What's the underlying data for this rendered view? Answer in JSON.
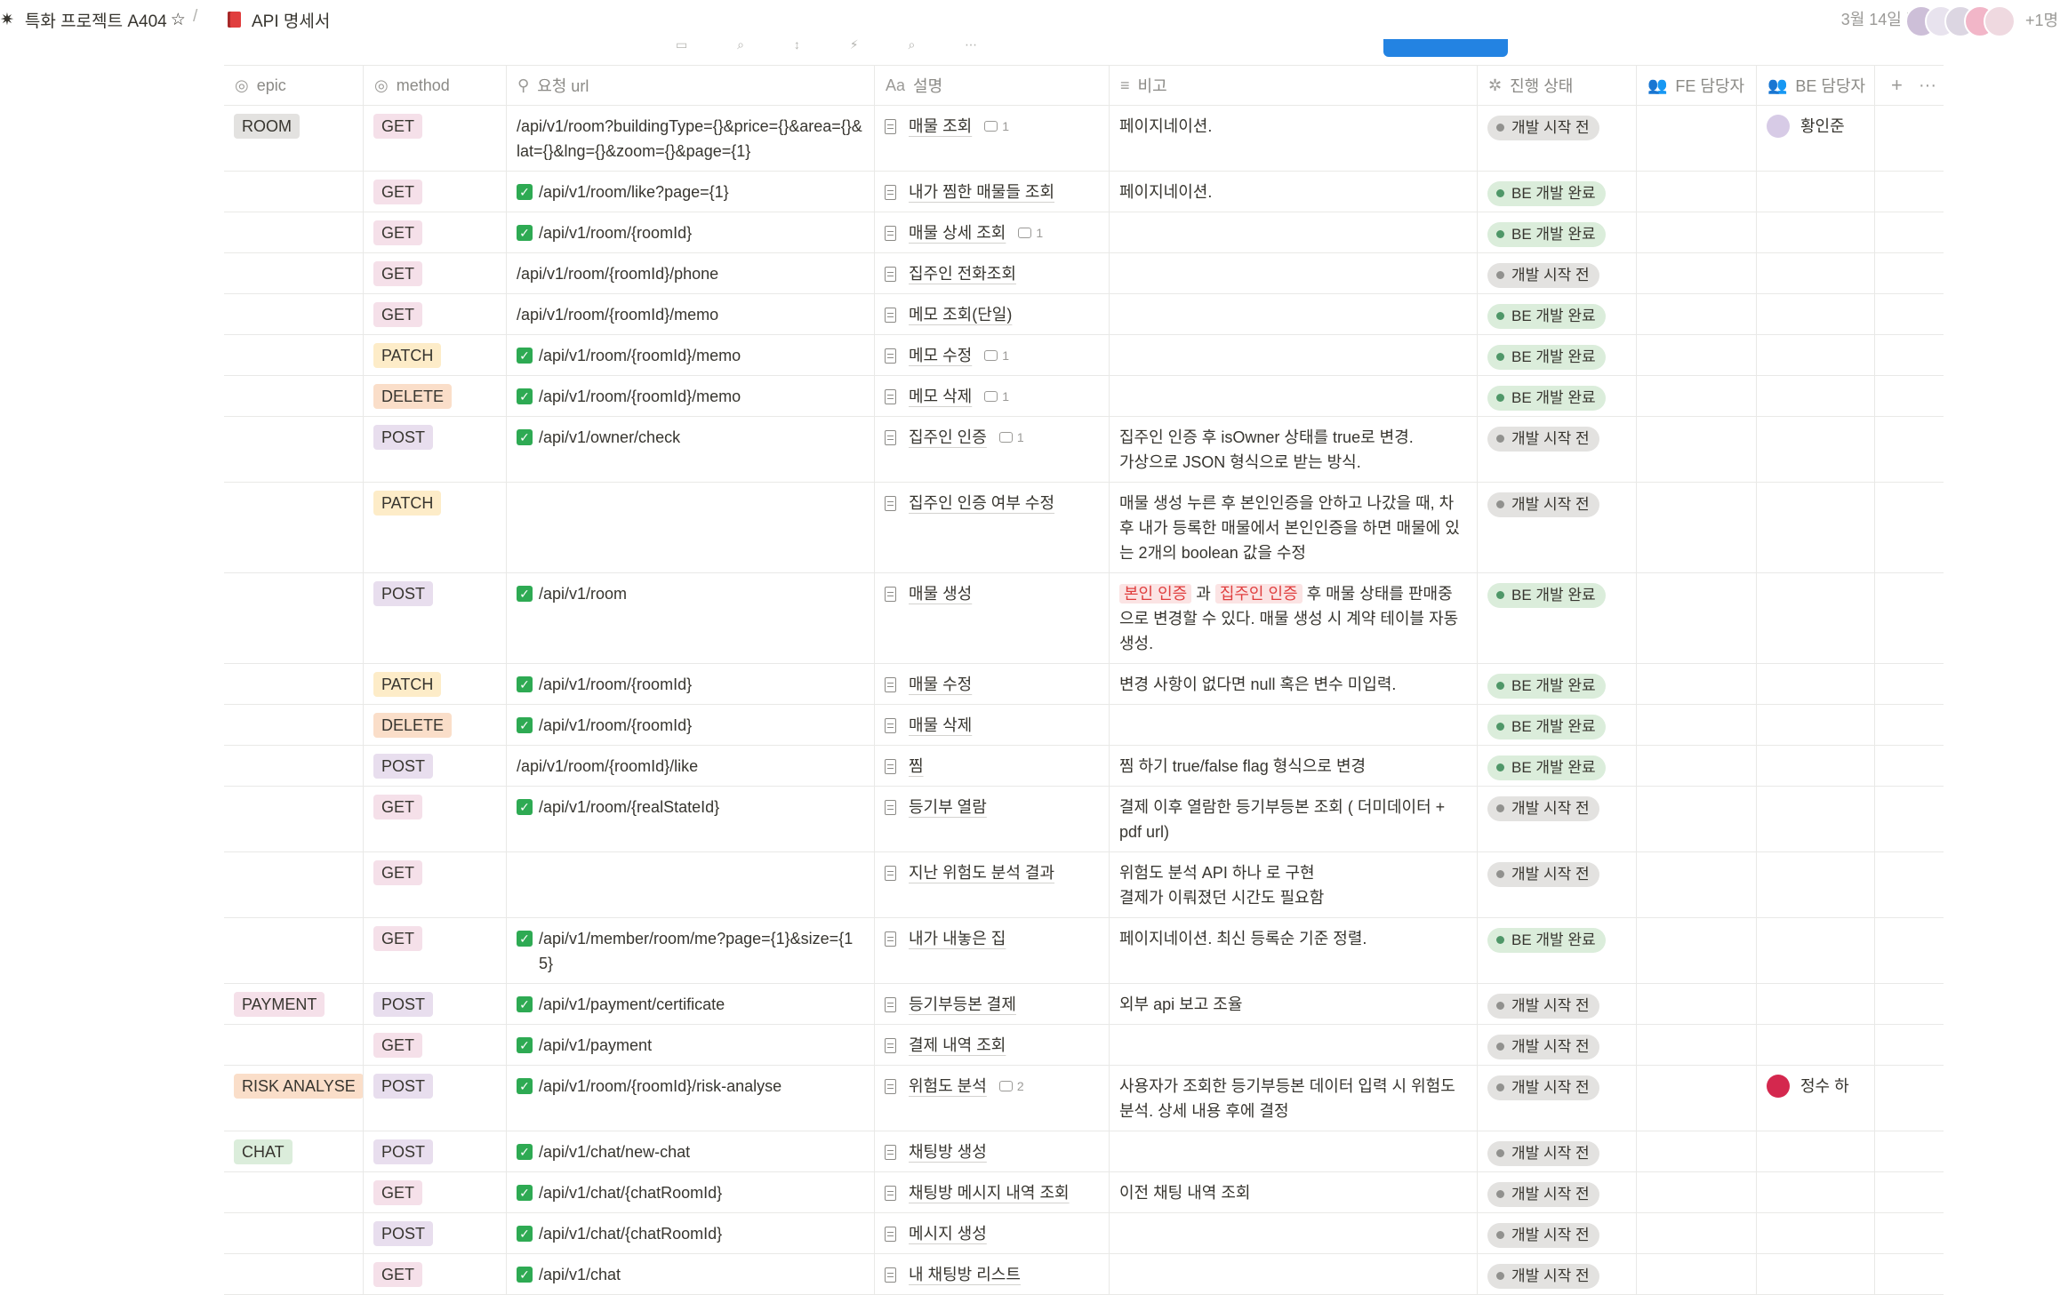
{
  "breadcrumb": {
    "workspace_icon": "✷",
    "project": "특화 프로젝트 A404",
    "star_icon": "☆",
    "separator": "/",
    "page_icon": "book-icon",
    "page": "API 명세서"
  },
  "header": {
    "edited": "3월 14일 편집",
    "more_people": "+1명"
  },
  "columns": [
    {
      "icon": "◎",
      "label": "epic"
    },
    {
      "icon": "◎",
      "label": "method"
    },
    {
      "icon": "⚲",
      "label": "요청 url"
    },
    {
      "icon": "Aa",
      "label": "설명"
    },
    {
      "icon": "≡",
      "label": "비고"
    },
    {
      "icon": "✲",
      "label": "진행 상태"
    },
    {
      "icon": "👥",
      "label": "FE 담당자"
    },
    {
      "icon": "👥",
      "label": "BE 담당자"
    }
  ],
  "add_column": "+",
  "more": "···",
  "tag_colors": {
    "ROOM": "#e3e2e0",
    "PAYMENT": "#f5e0e9",
    "RISK ANALYSE": "#fadec9",
    "CHAT": "#dbeddb",
    "GET": "#f5e0e9",
    "POST": "#e8deee",
    "PATCH": "#fdecc8",
    "DELETE": "#fadec9"
  },
  "status_styles": {
    "개발 시작 전": {
      "bg": "#e3e2e0",
      "dot": "#91918e"
    },
    "BE 개발 완료": {
      "bg": "#dbeddb",
      "dot": "#4f9768"
    }
  },
  "rows": [
    {
      "epic": "ROOM",
      "method": "GET",
      "url": "/api/v1/room?buildingType={}&price={}&area={}&lat={}&lng={}&zoom={}&page={1}",
      "checked": false,
      "desc": "매물 조회",
      "comments": "1",
      "note": "페이지네이션.",
      "status": "개발 시작 전",
      "fe": "",
      "be": "황인준"
    },
    {
      "epic": "",
      "method": "GET",
      "url": "/api/v1/room/like?page={1}",
      "checked": true,
      "desc": "내가 찜한 매물들 조회",
      "comments": "",
      "note": "페이지네이션.",
      "status": "BE 개발 완료",
      "fe": "",
      "be": ""
    },
    {
      "epic": "",
      "method": "GET",
      "url": "/api/v1/room/{roomId}",
      "checked": true,
      "desc": "매물 상세 조회",
      "comments": "1",
      "note": "",
      "status": "BE 개발 완료",
      "fe": "",
      "be": ""
    },
    {
      "epic": "",
      "method": "GET",
      "url": "/api/v1/room/{roomId}/phone",
      "checked": false,
      "desc": "집주인 전화조회",
      "comments": "",
      "note": "",
      "status": "개발 시작 전",
      "fe": "",
      "be": ""
    },
    {
      "epic": "",
      "method": "GET",
      "url": "/api/v1/room/{roomId}/memo",
      "checked": false,
      "desc": "메모 조회(단일)",
      "comments": "",
      "note": "",
      "status": "BE 개발 완료",
      "fe": "",
      "be": ""
    },
    {
      "epic": "",
      "method": "PATCH",
      "url": "/api/v1/room/{roomId}/memo",
      "checked": true,
      "desc": "메모 수정",
      "comments": "1",
      "note": "",
      "status": "BE 개발 완료",
      "fe": "",
      "be": ""
    },
    {
      "epic": "",
      "method": "DELETE",
      "url": "/api/v1/room/{roomId}/memo",
      "checked": true,
      "desc": "메모 삭제",
      "comments": "1",
      "note": "",
      "status": "BE 개발 완료",
      "fe": "",
      "be": ""
    },
    {
      "epic": "",
      "method": "POST",
      "url": "/api/v1/owner/check",
      "checked": true,
      "desc": "집주인 인증",
      "comments": "1",
      "note": "집주인 인증 후 isOwner 상태를 true로 변경.\n가상으로 JSON 형식으로 받는 방식.",
      "status": "개발 시작 전",
      "fe": "",
      "be": ""
    },
    {
      "epic": "",
      "method": "PATCH",
      "url": "",
      "checked": false,
      "desc": "집주인 인증 여부 수정",
      "comments": "",
      "note": "매물 생성 누른 후 본인인증을 안하고 나갔을 때, 차후 내가 등록한 매물에서 본인인증을 하면 매물에 있는 2개의 boolean 값을 수정",
      "status": "개발 시작 전",
      "fe": "",
      "be": ""
    },
    {
      "epic": "",
      "method": "POST",
      "url": "/api/v1/room",
      "checked": true,
      "desc": "매물 생성",
      "comments": "",
      "note_parts": [
        "본인 인증",
        " 과 ",
        "집주인 인증",
        " 후 매물 상태를 판매중으로 변경할 수 있다. 매물 생성 시 계약 테이블 자동 생성."
      ],
      "status": "BE 개발 완료",
      "fe": "",
      "be": ""
    },
    {
      "epic": "",
      "method": "PATCH",
      "url": "/api/v1/room/{roomId}",
      "checked": true,
      "desc": "매물 수정",
      "comments": "",
      "note": "변경 사항이 없다면 null 혹은 변수 미입력.",
      "status": "BE 개발 완료",
      "fe": "",
      "be": ""
    },
    {
      "epic": "",
      "method": "DELETE",
      "url": "/api/v1/room/{roomId}",
      "checked": true,
      "desc": "매물 삭제",
      "comments": "",
      "note": "",
      "status": "BE 개발 완료",
      "fe": "",
      "be": ""
    },
    {
      "epic": "",
      "method": "POST",
      "url": "/api/v1/room/{roomId}/like",
      "checked": false,
      "desc": "찜",
      "comments": "",
      "note": "찜 하기 true/false flag 형식으로 변경",
      "status": "BE 개발 완료",
      "fe": "",
      "be": ""
    },
    {
      "epic": "",
      "method": "GET",
      "url": "/api/v1/room/{realStateId}",
      "checked": true,
      "desc": "등기부 열람",
      "comments": "",
      "note": "결제 이후 열람한 등기부등본 조회 ( 더미데이터 + pdf url)",
      "status": "개발 시작 전",
      "fe": "",
      "be": ""
    },
    {
      "epic": "",
      "method": "GET",
      "url": "",
      "checked": false,
      "desc": "지난 위험도 분석 결과",
      "comments": "",
      "note": "위험도 분석 API 하나 로 구현\n결제가 이뤄졌던 시간도 필요함",
      "status": "개발 시작 전",
      "fe": "",
      "be": ""
    },
    {
      "epic": "",
      "method": "GET",
      "url": "/api/v1/member/room/me?page={1}&size={15}",
      "checked": true,
      "desc": "내가 내놓은 집",
      "comments": "",
      "note": "페이지네이션. 최신 등록순 기준 정렬.",
      "status": "BE 개발 완료",
      "fe": "",
      "be": ""
    },
    {
      "epic": "PAYMENT",
      "method": "POST",
      "url": "/api/v1/payment/certificate",
      "checked": true,
      "desc": "등기부등본 결제",
      "comments": "",
      "note": " 외부 api 보고 조율",
      "status": "개발 시작 전",
      "fe": "",
      "be": ""
    },
    {
      "epic": "",
      "method": "GET",
      "url": "/api/v1/payment",
      "checked": true,
      "desc": "결제 내역 조회",
      "comments": "",
      "note": "",
      "status": "개발 시작 전",
      "fe": "",
      "be": ""
    },
    {
      "epic": "RISK ANALYSE",
      "method": "POST",
      "url": "/api/v1/room/{roomId}/risk-analyse",
      "checked": true,
      "desc": "위험도 분석",
      "comments": "2",
      "note": "사용자가 조회한 등기부등본 데이터 입력 시 위험도 분석. 상세 내용 후에 결정",
      "status": "개발 시작 전",
      "fe": "",
      "be": "정수 하"
    },
    {
      "epic": "CHAT",
      "method": "POST",
      "url": "/api/v1/chat/new-chat",
      "checked": true,
      "desc": "채팅방 생성",
      "comments": "",
      "note": "",
      "status": "개발 시작 전",
      "fe": "",
      "be": ""
    },
    {
      "epic": "",
      "method": "GET",
      "url": "/api/v1/chat/{chatRoomId}",
      "checked": true,
      "desc": "채팅방 메시지 내역 조회",
      "comments": "",
      "note": "이전 채팅 내역 조회",
      "status": "개발 시작 전",
      "fe": "",
      "be": ""
    },
    {
      "epic": "",
      "method": "POST",
      "url": "/api/v1/chat/{chatRoomId}",
      "checked": true,
      "desc": "메시지 생성",
      "comments": "",
      "note": "",
      "status": "개발 시작 전",
      "fe": "",
      "be": ""
    },
    {
      "epic": "",
      "method": "GET",
      "url": "/api/v1/chat",
      "checked": true,
      "desc": "내 채팅방 리스트",
      "comments": "",
      "note": "",
      "status": "개발 시작 전",
      "fe": "",
      "be": ""
    }
  ]
}
